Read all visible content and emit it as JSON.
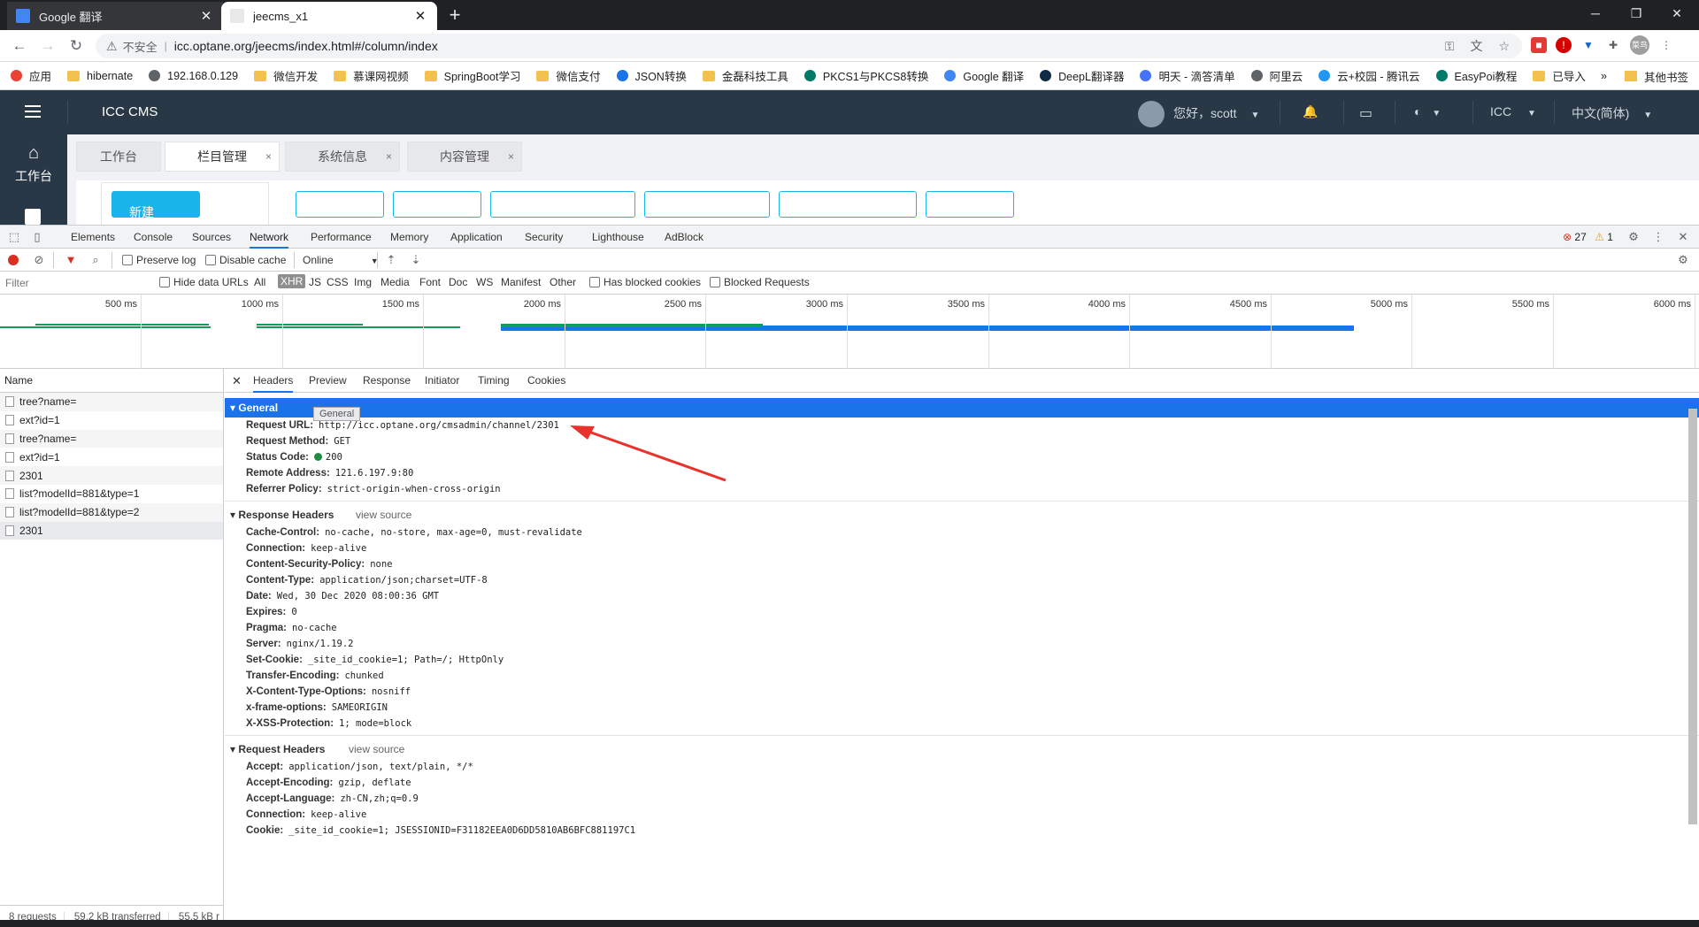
{
  "browser": {
    "tabs": [
      {
        "title": "Google 翻译",
        "active": false
      },
      {
        "title": "jeecms_x1",
        "active": true
      }
    ],
    "new_tab": "+",
    "insecure_label": "不安全",
    "url": "icc.optane.org/jeecms/index.html#/column/index",
    "profile_label": "菜鸟",
    "bookmarks": [
      {
        "label": "应用",
        "icon": "apps-icon"
      },
      {
        "label": "hibernate",
        "icon": "folder-icon"
      },
      {
        "label": "192.168.0.129",
        "icon": "globe-icon"
      },
      {
        "label": "微信开发",
        "icon": "folder-icon"
      },
      {
        "label": "慕课网视频",
        "icon": "folder-icon"
      },
      {
        "label": "SpringBoot学习",
        "icon": "folder-icon"
      },
      {
        "label": "微信支付",
        "icon": "folder-icon"
      },
      {
        "label": "JSON转换",
        "icon": "json-icon"
      },
      {
        "label": "金磊科技工具",
        "icon": "folder-icon"
      },
      {
        "label": "PKCS1与PKCS8转换",
        "icon": "site-icon"
      },
      {
        "label": "Google 翻译",
        "icon": "translate-icon"
      },
      {
        "label": "DeepL翻译器",
        "icon": "deepl-icon"
      },
      {
        "label": "明天 - 滴答清单",
        "icon": "check-icon"
      },
      {
        "label": "阿里云",
        "icon": "globe-icon"
      },
      {
        "label": "云+校园 - 腾讯云",
        "icon": "cloud-icon"
      },
      {
        "label": "EasyPoi教程",
        "icon": "site-icon"
      },
      {
        "label": "已导入",
        "icon": "folder-icon"
      }
    ],
    "bookmarks_more": "»",
    "other_bookmarks": "其他书签"
  },
  "cms": {
    "title": "ICC CMS",
    "greeting": "您好，scott",
    "site": "ICC",
    "language": "中文(简体)",
    "sidebar_home": "工作台",
    "tabs": [
      {
        "label": "工作台",
        "closable": false,
        "active": false
      },
      {
        "label": "栏目管理",
        "closable": true,
        "active": true
      },
      {
        "label": "系统信息",
        "closable": true,
        "active": false
      },
      {
        "label": "内容管理",
        "closable": true,
        "active": false
      }
    ],
    "close_glyph": "×",
    "new_button": "新建"
  },
  "devtools": {
    "panels": [
      "Elements",
      "Console",
      "Sources",
      "Network",
      "Performance",
      "Memory",
      "Application",
      "Security",
      "Lighthouse",
      "AdBlock"
    ],
    "active_panel": "Network",
    "errors": "27",
    "warnings": "1",
    "toolbar": {
      "preserve_log": "Preserve log",
      "disable_cache": "Disable cache",
      "throttle": "Online"
    },
    "filter": {
      "placeholder": "Filter",
      "hide_data_urls": "Hide data URLs",
      "types": [
        "All",
        "XHR",
        "JS",
        "CSS",
        "Img",
        "Media",
        "Font",
        "Doc",
        "WS",
        "Manifest",
        "Other"
      ],
      "selected_type": "XHR",
      "has_blocked_cookies": "Has blocked cookies",
      "blocked_requests": "Blocked Requests"
    },
    "timeline_labels": [
      "500 ms",
      "1000 ms",
      "1500 ms",
      "2000 ms",
      "2500 ms",
      "3000 ms",
      "3500 ms",
      "4000 ms",
      "4500 ms",
      "5000 ms",
      "5500 ms",
      "6000 ms"
    ],
    "name_header": "Name",
    "requests": [
      "tree?name=",
      "ext?id=1",
      "tree?name=",
      "ext?id=1",
      "2301",
      "list?modelId=881&type=1",
      "list?modelId=881&type=2",
      "2301"
    ],
    "summary": {
      "requests": "8 requests",
      "transferred": "59.2 kB transferred",
      "resources": "55.5 kB r"
    },
    "detail_tabs": [
      "Headers",
      "Preview",
      "Response",
      "Initiator",
      "Timing",
      "Cookies"
    ],
    "general": {
      "title": "General",
      "tooltip": "General",
      "rows": [
        {
          "k": "Request URL:",
          "v": "http://icc.optane.org/cmsadmin/channel/2301"
        },
        {
          "k": "Request Method:",
          "v": "GET"
        },
        {
          "k": "Status Code:",
          "v": "200"
        },
        {
          "k": "Remote Address:",
          "v": "121.6.197.9:80"
        },
        {
          "k": "Referrer Policy:",
          "v": "strict-origin-when-cross-origin"
        }
      ]
    },
    "response_headers": {
      "title": "Response Headers",
      "view_source": "view source",
      "rows": [
        {
          "k": "Cache-Control:",
          "v": "no-cache, no-store, max-age=0, must-revalidate"
        },
        {
          "k": "Connection:",
          "v": "keep-alive"
        },
        {
          "k": "Content-Security-Policy:",
          "v": "none"
        },
        {
          "k": "Content-Type:",
          "v": "application/json;charset=UTF-8"
        },
        {
          "k": "Date:",
          "v": "Wed, 30 Dec 2020 08:00:36 GMT"
        },
        {
          "k": "Expires:",
          "v": "0"
        },
        {
          "k": "Pragma:",
          "v": "no-cache"
        },
        {
          "k": "Server:",
          "v": "nginx/1.19.2"
        },
        {
          "k": "Set-Cookie:",
          "v": "_site_id_cookie=1; Path=/; HttpOnly"
        },
        {
          "k": "Transfer-Encoding:",
          "v": "chunked"
        },
        {
          "k": "X-Content-Type-Options:",
          "v": "nosniff"
        },
        {
          "k": "x-frame-options:",
          "v": "SAMEORIGIN"
        },
        {
          "k": "X-XSS-Protection:",
          "v": "1; mode=block"
        }
      ]
    },
    "request_headers": {
      "title": "Request Headers",
      "view_source": "view source",
      "rows": [
        {
          "k": "Accept:",
          "v": "application/json, text/plain, */*"
        },
        {
          "k": "Accept-Encoding:",
          "v": "gzip, deflate"
        },
        {
          "k": "Accept-Language:",
          "v": "zh-CN,zh;q=0.9"
        },
        {
          "k": "Connection:",
          "v": "keep-alive"
        },
        {
          "k": "Cookie:",
          "v": "_site_id_cookie=1; JSESSIONID=F31182EEA0D6DD5810AB6BFC881197C1"
        }
      ]
    }
  },
  "colors": {
    "cms_header": "#293846",
    "accent": "#1ab5e8",
    "devtools_selected": "#1a73e8",
    "status_ok": "#1e8e3e",
    "annotation_arrow": "#e8322b"
  }
}
